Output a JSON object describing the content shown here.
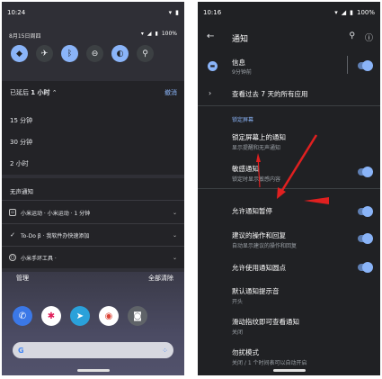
{
  "left": {
    "status_time": "10:24",
    "qs_date": "8月15日周四",
    "battery": "100%",
    "snooze_prefix": "已延后",
    "snooze_duration": "1 小时",
    "undo": "撤消",
    "options": [
      "15 分钟",
      "30 分钟",
      "2 小时"
    ],
    "silent_header": "无声通知",
    "notifications": [
      {
        "text": "小米运动 · 小米运动 · 1 分钟"
      },
      {
        "text": "To-Do β · 我软件办快速添加"
      },
      {
        "text": "小米手环工具 ·"
      }
    ],
    "manage": "管理",
    "clear_all": "全部清除"
  },
  "right": {
    "status_time": "10:16",
    "battery": "100%",
    "title": "通知",
    "info_title": "信息",
    "info_sub": "9分钟前",
    "see_all": "查看过去 7 天的所有应用",
    "section": "锁定屏幕",
    "rows": [
      {
        "title": "锁定屏幕上的通知",
        "sub": "显示提醒和无声通知"
      },
      {
        "title": "敏感通知",
        "sub": "锁定时显示敏感内容"
      },
      {
        "title": "允许通知暂停",
        "sub": ""
      },
      {
        "title": "建议的操作和回复",
        "sub": "自动显示建议的操作和回复"
      },
      {
        "title": "允许使用通知圆点",
        "sub": ""
      },
      {
        "title": "默认通知提示音",
        "sub": "开头"
      },
      {
        "title": "滑动指纹即可查看通知",
        "sub": "关闭"
      },
      {
        "title": "勿扰模式",
        "sub": "关闭 / 1 个时间表可以自动开启"
      }
    ]
  },
  "colors": {
    "accent": "#8ab4f8",
    "arrow": "#e02020"
  }
}
